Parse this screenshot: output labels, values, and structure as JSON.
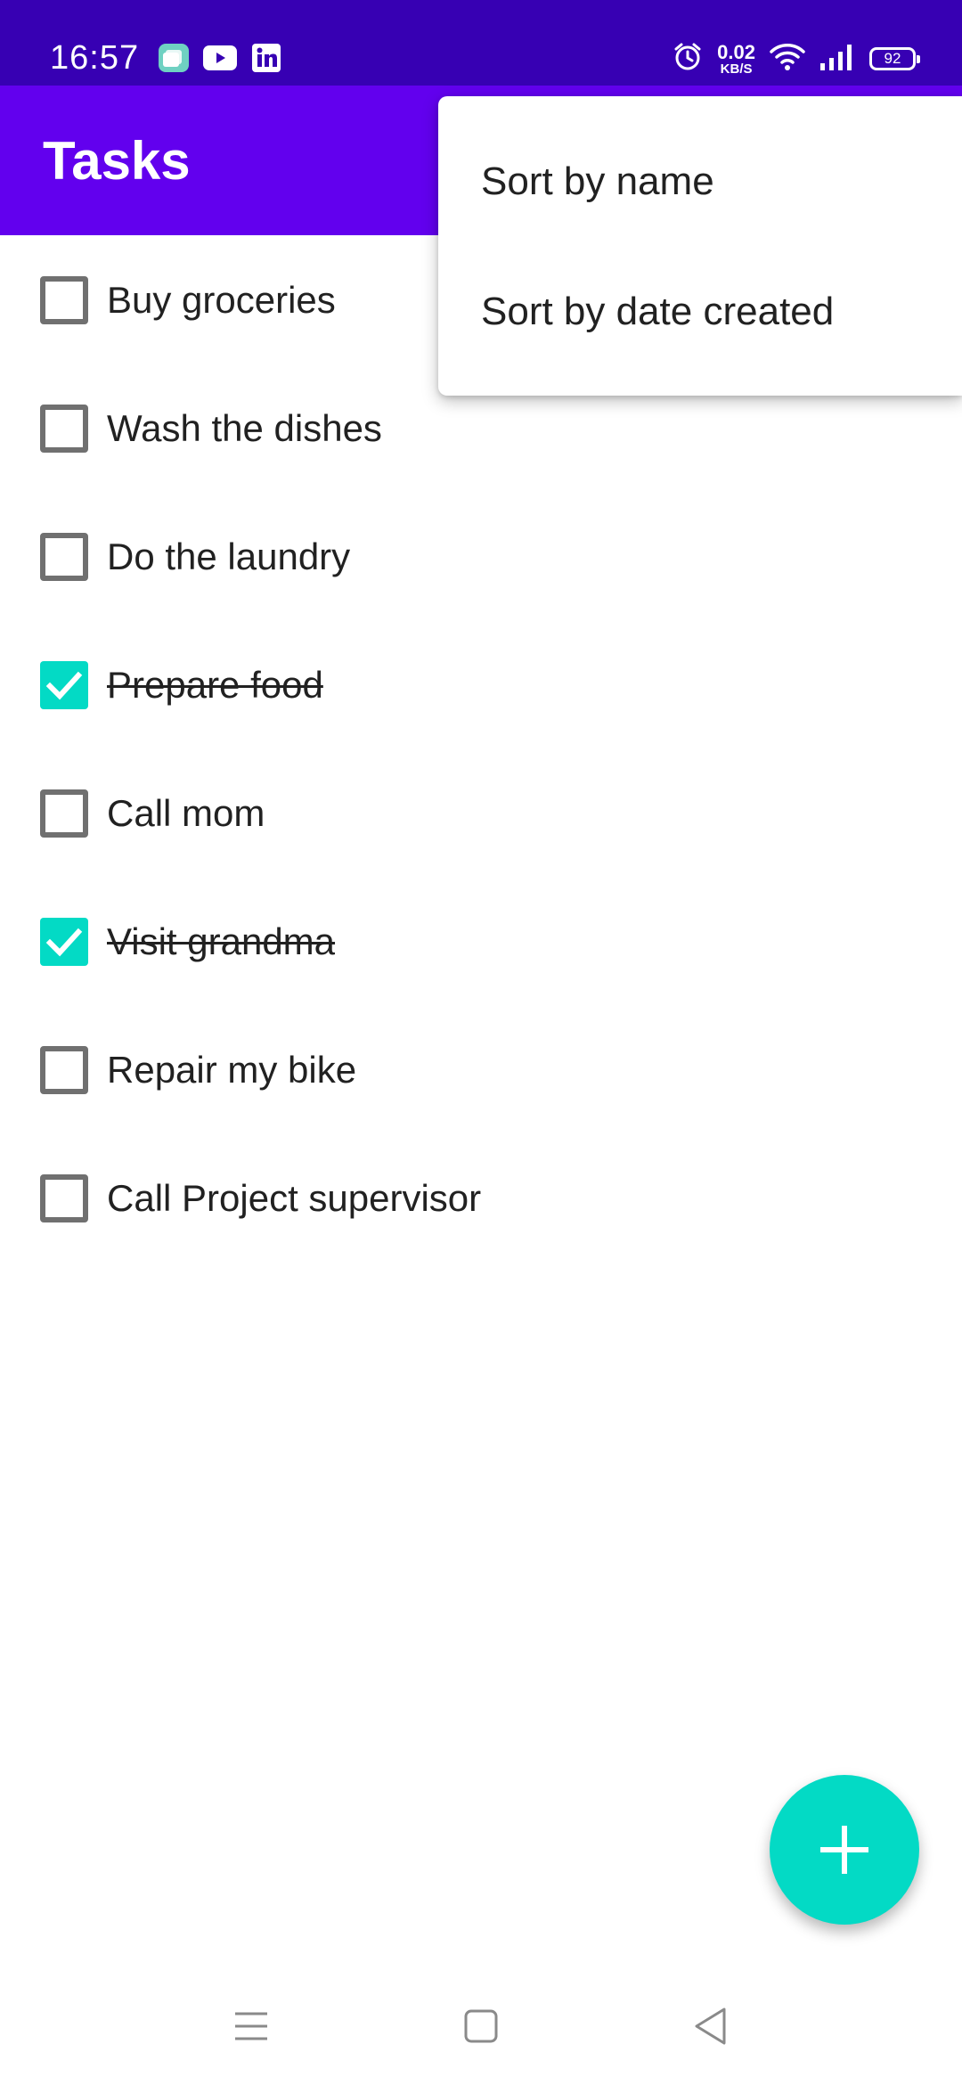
{
  "status_bar": {
    "time": "16:57",
    "app_icons": [
      "messages-icon",
      "youtube-icon",
      "linkedin-icon"
    ],
    "net_speed_value": "0.02",
    "net_speed_unit": "KB/S",
    "battery": "92"
  },
  "app_bar": {
    "title": "Tasks"
  },
  "tasks": [
    {
      "label": "Buy groceries",
      "done": false
    },
    {
      "label": "Wash the dishes",
      "done": false
    },
    {
      "label": "Do the laundry",
      "done": false
    },
    {
      "label": "Prepare food",
      "done": true
    },
    {
      "label": "Call mom",
      "done": false
    },
    {
      "label": "Visit grandma",
      "done": true
    },
    {
      "label": "Repair my bike",
      "done": false
    },
    {
      "label": "Call Project supervisor",
      "done": false
    }
  ],
  "menu": {
    "items": [
      "Sort by name",
      "Sort by date created"
    ]
  },
  "fab": {
    "icon": "plus-icon"
  },
  "nav_bar": {
    "icons": [
      "recent-apps-icon",
      "home-icon",
      "back-icon"
    ]
  },
  "colors": {
    "status_bar": "#3700B3",
    "app_bar": "#6200EE",
    "accent": "#03DAC5"
  }
}
